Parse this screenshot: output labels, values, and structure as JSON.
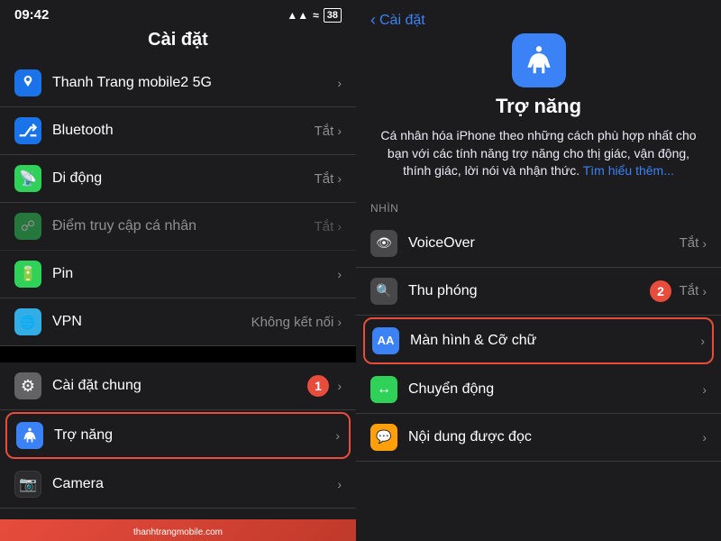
{
  "left": {
    "statusBar": {
      "time": "09:42",
      "signal": "▲▲▲",
      "wifi": "WiFi",
      "battery": "38"
    },
    "header": "Cài đặt",
    "items": [
      {
        "id": "thanhtrang",
        "label": "Thanh Trang mobile2 5G",
        "value": "",
        "iconColor": "icon-blue",
        "iconText": "T",
        "dimmed": false
      },
      {
        "id": "bluetooth",
        "label": "Bluetooth",
        "value": "Tắt",
        "iconColor": "icon-blue",
        "iconText": "BT",
        "dimmed": false
      },
      {
        "id": "diDong",
        "label": "Di động",
        "value": "Tắt",
        "iconColor": "icon-green",
        "iconText": "📡",
        "dimmed": false
      },
      {
        "id": "diemTruy",
        "label": "Điểm truy cập cá nhân",
        "value": "Tắt",
        "iconColor": "icon-green",
        "iconText": "⚑",
        "dimmed": true
      },
      {
        "id": "pin",
        "label": "Pin",
        "value": "",
        "iconColor": "icon-green",
        "iconText": "🔋",
        "dimmed": false
      },
      {
        "id": "vpn",
        "label": "VPN",
        "value": "Không kết nối",
        "iconColor": "icon-teal",
        "iconText": "🌐",
        "dimmed": false
      },
      {
        "id": "caiDatChung",
        "label": "Cài đặt chung",
        "value": "",
        "iconColor": "icon-gray",
        "iconText": "⚙",
        "dimmed": false,
        "badge": "1"
      },
      {
        "id": "troNang",
        "label": "Trợ năng",
        "value": "",
        "iconColor": "icon-accessibility",
        "iconText": "♿",
        "dimmed": false,
        "highlighted": true
      },
      {
        "id": "camera",
        "label": "Camera",
        "value": "",
        "iconColor": "icon-camera",
        "iconText": "📷",
        "dimmed": false
      }
    ]
  },
  "right": {
    "backLabel": "Cài đặt",
    "title": "Trợ năng",
    "description": "Cá nhân hóa iPhone theo những cách phù hợp nhất cho bạn với các tính năng trợ năng cho thị giác, vận động, thính giác, lời nói và nhận thức.",
    "linkText": "Tìm hiểu thêm...",
    "sectionNhin": "NHÌN",
    "items": [
      {
        "id": "voiceover",
        "label": "VoiceOver",
        "value": "Tắt",
        "iconColor": "icon-voiceover",
        "iconText": "👁",
        "badge": ""
      },
      {
        "id": "thuPhong",
        "label": "Thu phóng",
        "value": "Tắt",
        "iconColor": "icon-zoom",
        "iconText": "🔍",
        "badge": "2"
      },
      {
        "id": "manHinh",
        "label": "Màn hình & Cỡ chữ",
        "value": "",
        "iconColor": "icon-display",
        "iconText": "AA",
        "highlighted": true
      },
      {
        "id": "chuyenDong",
        "label": "Chuyển động",
        "value": "",
        "iconColor": "icon-motion",
        "iconText": "↔",
        "badge": ""
      },
      {
        "id": "noiDung",
        "label": "Nội dung được đọc",
        "value": "",
        "iconColor": "icon-spoken",
        "iconText": "💬",
        "badge": ""
      }
    ]
  },
  "watermark": {
    "line1": "thanhtrangmobile",
    "line2": ".com"
  }
}
